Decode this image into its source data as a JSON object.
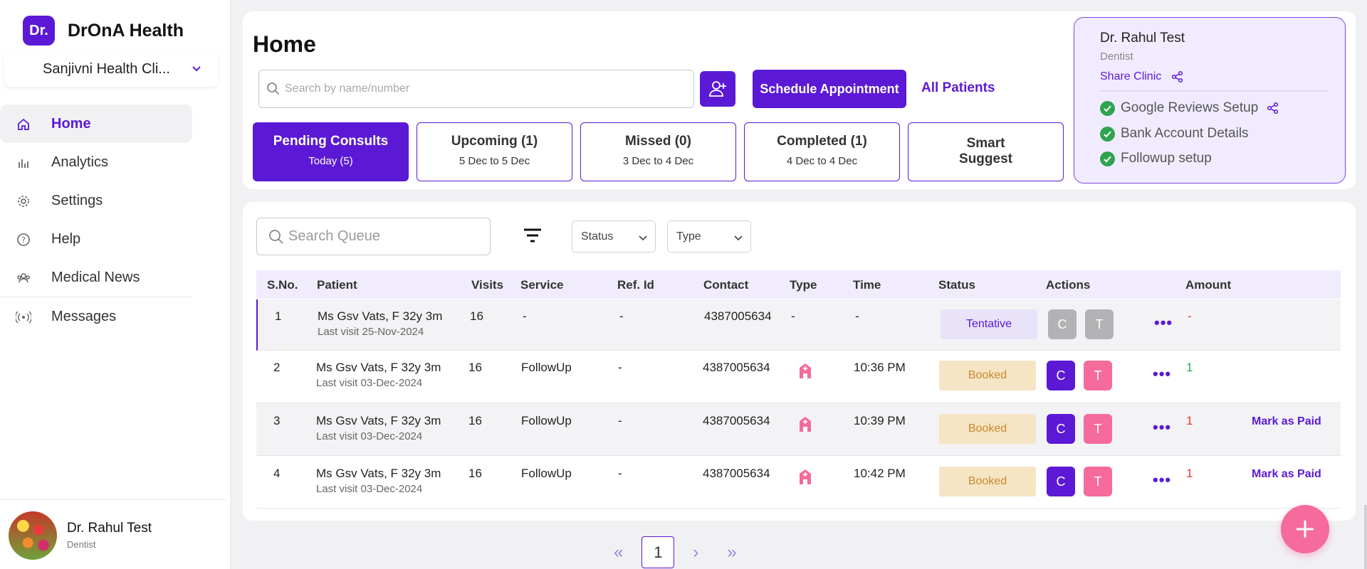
{
  "brand": {
    "logo_text": "Dr.",
    "name": "DrOnA Health"
  },
  "clinic": {
    "selected": "Sanjivni Health Cli..."
  },
  "nav": [
    {
      "label": "Home",
      "icon": "home-icon"
    },
    {
      "label": "Analytics",
      "icon": "analytics-icon"
    },
    {
      "label": "Settings",
      "icon": "settings-icon"
    },
    {
      "label": "Help",
      "icon": "help-icon"
    },
    {
      "label": "Medical News",
      "icon": "medical-news-icon"
    },
    {
      "label": "Messages",
      "icon": "messages-icon"
    }
  ],
  "profile": {
    "name": "Dr. Rahul Test",
    "role": "Dentist"
  },
  "header": {
    "title": "Home",
    "search_placeholder": "Search by name/number",
    "schedule_label": "Schedule Appointment",
    "all_patients_label": "All Patients"
  },
  "tabs": [
    {
      "title": "Pending Consults",
      "subtitle": "Today (5)"
    },
    {
      "title": "Upcoming (1)",
      "subtitle": "5 Dec to 5 Dec"
    },
    {
      "title": "Missed (0)",
      "subtitle": "3 Dec to 4 Dec"
    },
    {
      "title": "Completed (1)",
      "subtitle": "4 Dec to 4 Dec"
    },
    {
      "title": "Smart Suggest",
      "subtitle": ""
    }
  ],
  "doctor_card": {
    "name": "Dr. Rahul Test",
    "role": "Dentist",
    "share_label": "Share Clinic",
    "checks": [
      "Google Reviews Setup",
      "Bank Account Details",
      "Followup setup"
    ]
  },
  "queue": {
    "search_placeholder": "Search Queue",
    "status_filter": "Status",
    "type_filter": "Type",
    "columns": [
      "S.No.",
      "Patient",
      "Visits",
      "Service",
      "Ref. Id",
      "Contact",
      "Type",
      "Time",
      "Status",
      "Actions",
      "Amount"
    ],
    "rows": [
      {
        "sno": "1",
        "patient": "Ms Gsv Vats, F 32y 3m",
        "last_visit": "Last visit 25-Nov-2024",
        "visits": "16",
        "service": "-",
        "ref": "-",
        "contact": "4387005634",
        "type": "-",
        "time": "-",
        "status": "Tentative",
        "c": "C",
        "t": "T",
        "more": "•••",
        "amount": "-",
        "paid": ""
      },
      {
        "sno": "2",
        "patient": "Ms Gsv Vats, F 32y 3m",
        "last_visit": "Last visit 03-Dec-2024",
        "visits": "16",
        "service": "FollowUp",
        "ref": "-",
        "contact": "4387005634",
        "type": "clinic-icon",
        "time": "10:36 PM",
        "status": "Booked",
        "c": "C",
        "t": "T",
        "more": "•••",
        "amount": "1",
        "paid": ""
      },
      {
        "sno": "3",
        "patient": "Ms Gsv Vats, F 32y 3m",
        "last_visit": "Last visit 03-Dec-2024",
        "visits": "16",
        "service": "FollowUp",
        "ref": "-",
        "contact": "4387005634",
        "type": "clinic-icon",
        "time": "10:39 PM",
        "status": "Booked",
        "c": "C",
        "t": "T",
        "more": "•••",
        "amount": "1",
        "paid": "Mark as Paid"
      },
      {
        "sno": "4",
        "patient": "Ms Gsv Vats, F 32y 3m",
        "last_visit": "Last visit 03-Dec-2024",
        "visits": "16",
        "service": "FollowUp",
        "ref": "-",
        "contact": "4387005634",
        "type": "clinic-icon",
        "time": "10:42 PM",
        "status": "Booked",
        "c": "C",
        "t": "T",
        "more": "•••",
        "amount": "1",
        "paid": "Mark as Paid"
      }
    ]
  },
  "pagination": {
    "first": "«",
    "prev": "‹",
    "current": "1",
    "next": "›",
    "last": "»"
  },
  "colors": {
    "primary": "#5b19d6",
    "pink": "#f46b9c",
    "success": "#2ea44f",
    "booked_bg": "#f5e5c5"
  }
}
